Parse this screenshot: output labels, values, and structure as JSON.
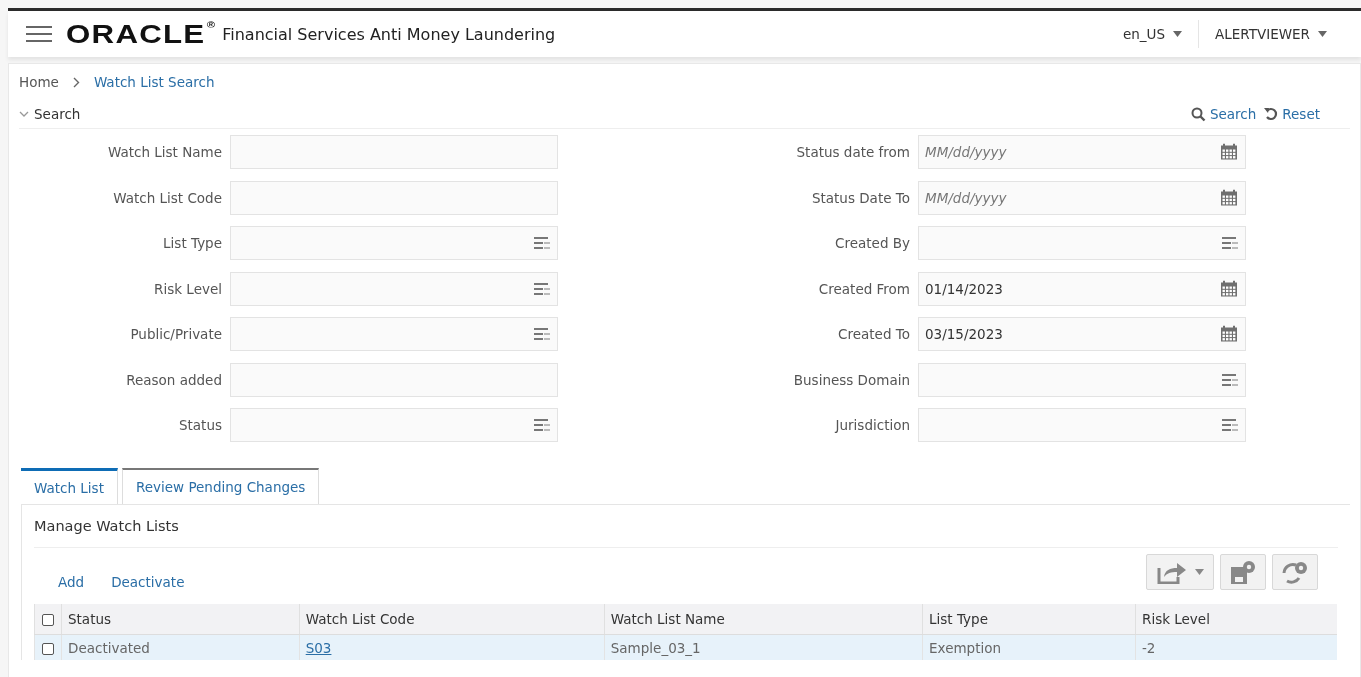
{
  "header": {
    "logo": "ORACLE",
    "logo_mark": "®",
    "product": "Financial Services Anti Money Laundering",
    "locale": "en_US",
    "user": "ALERTVIEWER"
  },
  "breadcrumb": [
    "Home",
    "Watch List Search"
  ],
  "search": {
    "title": "Search",
    "expanded": true,
    "actions": [
      "Search",
      "Reset"
    ],
    "left_fields": [
      {
        "label": "Watch List Name",
        "kind": "text"
      },
      {
        "label": "Watch List Code",
        "kind": "text"
      },
      {
        "label": "List Type",
        "kind": "select"
      },
      {
        "label": "Risk Level",
        "kind": "select"
      },
      {
        "label": "Public/Private",
        "kind": "select"
      },
      {
        "label": "Reason added",
        "kind": "text"
      },
      {
        "label": "Status",
        "kind": "select"
      }
    ],
    "right_fields": [
      {
        "label": "Status date from",
        "kind": "date",
        "placeholder": "MM/dd/yyyy"
      },
      {
        "label": "Status Date To",
        "kind": "date",
        "placeholder": "MM/dd/yyyy"
      },
      {
        "label": "Created By",
        "kind": "select"
      },
      {
        "label": "Created From",
        "kind": "date",
        "value": "01/14/2023"
      },
      {
        "label": "Created To",
        "kind": "date",
        "value": "03/15/2023"
      },
      {
        "label": "Business Domain",
        "kind": "select"
      },
      {
        "label": "Jurisdiction",
        "kind": "select"
      }
    ]
  },
  "tabs": [
    {
      "label": "Watch List",
      "selected": true
    },
    {
      "label": "Review Pending Changes",
      "selected": false
    }
  ],
  "manage": {
    "title": "Manage Watch Lists",
    "actions": [
      "Add",
      "Deactivate"
    ]
  },
  "table": {
    "header_checked": false,
    "columns": [
      "Status",
      "Watch List Code",
      "Watch List Name",
      "List Type",
      "Risk Level"
    ],
    "rows": [
      {
        "checked": false,
        "cells": [
          "Deactivated",
          "S03",
          "Sample_03_1",
          "Exemption",
          "-2"
        ]
      }
    ]
  }
}
